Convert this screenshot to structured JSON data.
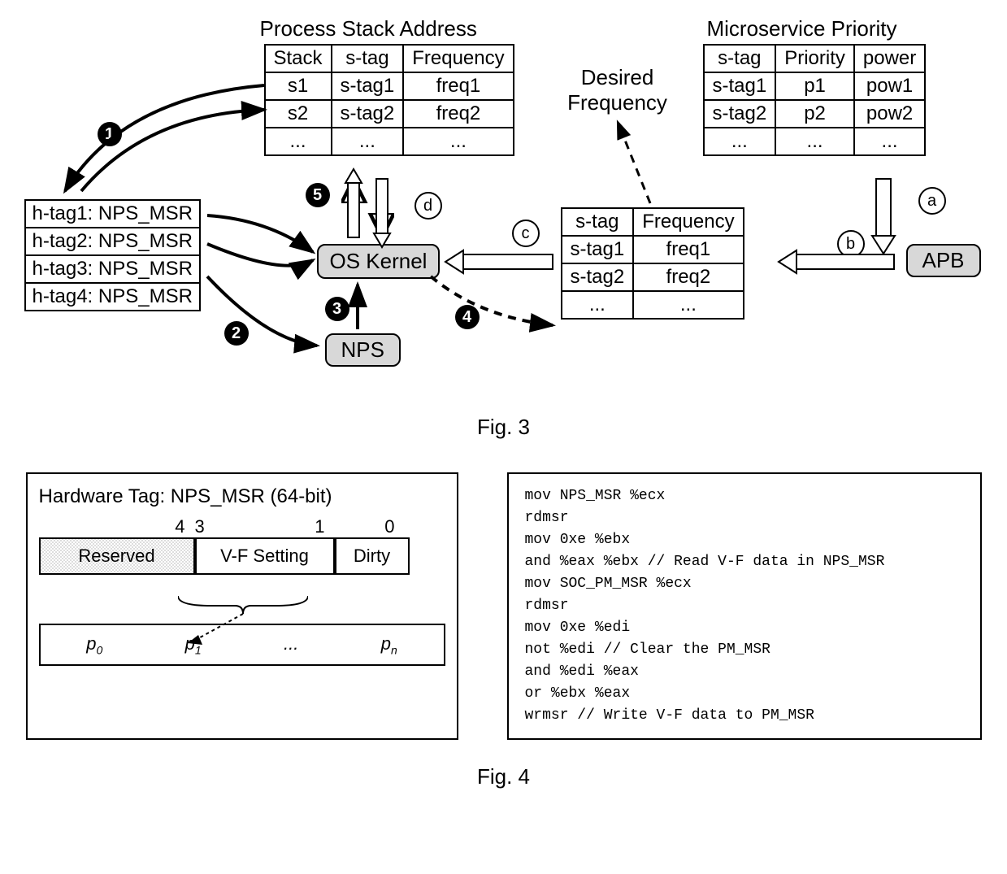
{
  "fig3": {
    "processStackTitle": "Process Stack Address",
    "psa_headers": {
      "h1": "Stack",
      "h2": "s-tag",
      "h3": "Frequency"
    },
    "psa_rows": {
      "r1": {
        "c1": "s1",
        "c2": "s-tag1",
        "c3": "freq1"
      },
      "r2": {
        "c1": "s2",
        "c2": "s-tag2",
        "c3": "freq2"
      },
      "r3": {
        "c1": "...",
        "c2": "...",
        "c3": "..."
      }
    },
    "microPriTitle": "Microservice Priority",
    "mp_headers": {
      "h1": "s-tag",
      "h2": "Priority",
      "h3": "power"
    },
    "mp_rows": {
      "r1": {
        "c1": "s-tag1",
        "c2": "p1",
        "c3": "pow1"
      },
      "r2": {
        "c1": "s-tag2",
        "c2": "p2",
        "c3": "pow2"
      },
      "r3": {
        "c1": "...",
        "c2": "...",
        "c3": "..."
      }
    },
    "htags": {
      "h1": "h-tag1: NPS_MSR",
      "h2": "h-tag2: NPS_MSR",
      "h3": "h-tag3: NPS_MSR",
      "h4": "h-tag4: NPS_MSR"
    },
    "osKernel": "OS Kernel",
    "nps": "NPS",
    "apb": "APB",
    "desiredFrequency": "Desired Frequency",
    "freqTable_headers": {
      "h1": "s-tag",
      "h2": "Frequency"
    },
    "freqTable_rows": {
      "r1": {
        "c1": "s-tag1",
        "c2": "freq1"
      },
      "r2": {
        "c1": "s-tag2",
        "c2": "freq2"
      },
      "r3": {
        "c1": "...",
        "c2": "..."
      }
    },
    "badges": {
      "n1": "1",
      "n2": "2",
      "n3": "3",
      "n4": "4",
      "n5": "5",
      "la": "a",
      "lb": "b",
      "lc": "c",
      "ld": "d"
    }
  },
  "captions": {
    "fig3": "Fig. 3",
    "fig4": "Fig. 4"
  },
  "fig4": {
    "msrTitle": "Hardware Tag:  NPS_MSR (64-bit)",
    "bits": {
      "b4": "4",
      "b3": "3",
      "b1": "1",
      "b0": "0"
    },
    "fields": {
      "reserved": "Reserved",
      "vf": "V-F Setting",
      "dirty": "Dirty"
    },
    "pbar": {
      "p0": "p",
      "p0sub": "0",
      "p1": "p",
      "p1sub": "1",
      "dots": "...",
      "pn": "p",
      "pnsub": "n"
    },
    "asm": "mov NPS_MSR %ecx\nrdmsr\nmov 0xe %ebx\nand %eax %ebx // Read V-F data in NPS_MSR\nmov SOC_PM_MSR %ecx\nrdmsr\nmov 0xe %edi\nnot %edi // Clear the PM_MSR\nand %edi %eax\nor %ebx %eax\nwrmsr // Write V-F data to PM_MSR"
  }
}
